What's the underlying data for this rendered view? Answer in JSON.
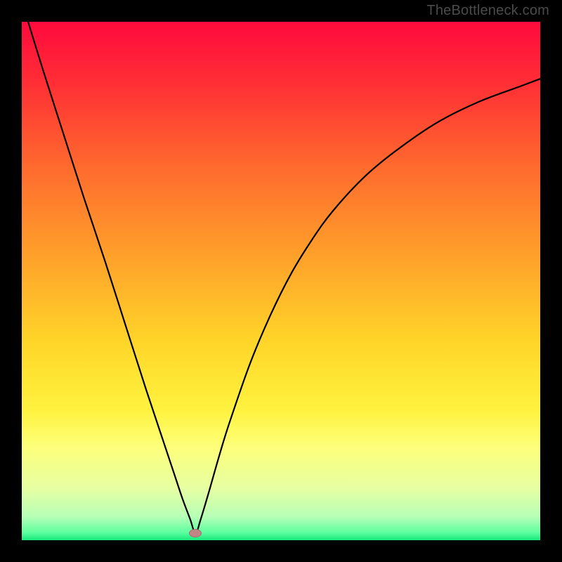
{
  "watermark": "TheBottleneck.com",
  "chart_data": {
    "type": "line",
    "title": "",
    "xlabel": "",
    "ylabel": "",
    "xlim": [
      0,
      100
    ],
    "ylim": [
      0,
      100
    ],
    "grid": false,
    "legend": false,
    "marker": {
      "x": 33.5,
      "y": 1.3,
      "color": "#c28585"
    },
    "gradient_stops": [
      {
        "pos": 0.0,
        "color": "#ff0a3d"
      },
      {
        "pos": 0.12,
        "color": "#ff2f35"
      },
      {
        "pos": 0.28,
        "color": "#ff6a2e"
      },
      {
        "pos": 0.45,
        "color": "#ffa02a"
      },
      {
        "pos": 0.62,
        "color": "#ffd629"
      },
      {
        "pos": 0.75,
        "color": "#fff33f"
      },
      {
        "pos": 0.82,
        "color": "#fdff7a"
      },
      {
        "pos": 0.9,
        "color": "#e7ffa3"
      },
      {
        "pos": 0.955,
        "color": "#b6ffb6"
      },
      {
        "pos": 0.985,
        "color": "#5cffa0"
      },
      {
        "pos": 1.0,
        "color": "#17e879"
      }
    ],
    "series": [
      {
        "name": "bottleneck-curve",
        "x": [
          0,
          4,
          8,
          12,
          16,
          20,
          24,
          27,
          29.5,
          31,
          32.5,
          33.5,
          34.5,
          36,
          38,
          40,
          44,
          48,
          52,
          56,
          60,
          66,
          72,
          80,
          88,
          96,
          100
        ],
        "y": [
          104,
          91,
          78.5,
          66,
          54,
          41.5,
          29,
          20,
          12.5,
          8,
          4,
          1.3,
          4,
          9,
          16,
          22.5,
          34,
          43.5,
          51.5,
          58,
          63.5,
          70,
          75,
          80.5,
          84.5,
          87.5,
          89
        ]
      }
    ]
  }
}
